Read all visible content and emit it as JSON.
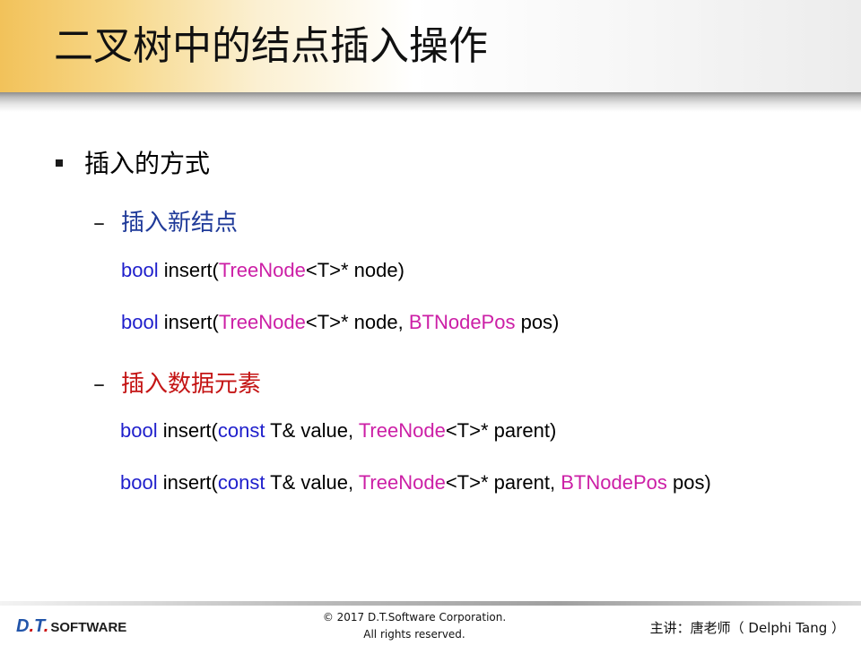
{
  "slide": {
    "title": "二叉树中的结点插入操作",
    "bullet": "插入的方式",
    "sections": [
      {
        "dash": "–",
        "heading": "插入新结点",
        "heading_color": "#1f3a99",
        "lines": [
          [
            {
              "t": "bool",
              "k": "kw"
            },
            {
              "t": " insert(",
              "k": ""
            },
            {
              "t": "TreeNode",
              "k": "ty"
            },
            {
              "t": "<T>* node)",
              "k": ""
            }
          ],
          [
            {
              "t": "bool",
              "k": "kw"
            },
            {
              "t": " insert(",
              "k": ""
            },
            {
              "t": "TreeNode",
              "k": "ty"
            },
            {
              "t": "<T>* node, ",
              "k": ""
            },
            {
              "t": "BTNodePos",
              "k": "ty"
            },
            {
              "t": " pos)",
              "k": ""
            }
          ]
        ]
      },
      {
        "dash": "–",
        "heading": "插入数据元素",
        "heading_color": "#c41515",
        "lines": [
          [
            {
              "t": "bool",
              "k": "kw"
            },
            {
              "t": " insert(",
              "k": ""
            },
            {
              "t": "const",
              "k": "kw"
            },
            {
              "t": " T& value, ",
              "k": ""
            },
            {
              "t": "TreeNode",
              "k": "ty"
            },
            {
              "t": "<T>* parent)",
              "k": ""
            }
          ],
          [
            {
              "t": "bool",
              "k": "kw"
            },
            {
              "t": " insert(",
              "k": ""
            },
            {
              "t": "const",
              "k": "kw"
            },
            {
              "t": " T& value, ",
              "k": ""
            },
            {
              "t": "TreeNode",
              "k": "ty"
            },
            {
              "t": "<T>* parent,  ",
              "k": ""
            },
            {
              "t": "BTNodePos",
              "k": "ty"
            },
            {
              "t": " pos)",
              "k": ""
            }
          ]
        ]
      }
    ]
  },
  "footer": {
    "logo_d": "D",
    "logo_dot": ".",
    "logo_t": "T",
    "logo_dot2": ".",
    "logo_software": "SOFTWARE",
    "copyright_line1": "© 2017 D.T.Software Corporation.",
    "copyright_line2": "All rights reserved.",
    "speaker": "主讲：唐老师（ Delphi Tang ）"
  }
}
